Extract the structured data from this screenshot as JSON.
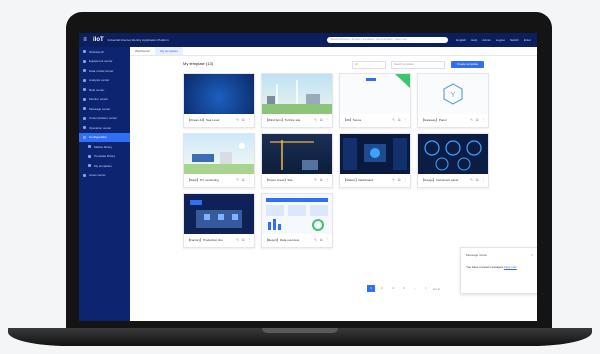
{
  "topbar": {
    "logo": "iIoT",
    "title": "Industrial Internet Identity Application Platform",
    "search_placeholder": "Search functions / devices / templates / documentation / alarm logs",
    "right_items": [
      "English",
      "Help",
      "Admin",
      "Logout",
      "Switch",
      "Enter"
    ]
  },
  "sidebar": {
    "items": [
      {
        "label": "Workbench"
      },
      {
        "label": "Equipment center"
      },
      {
        "label": "Data model center"
      },
      {
        "label": "Analysis center"
      },
      {
        "label": "Rule center"
      },
      {
        "label": "Monitor center"
      },
      {
        "label": "Message center"
      },
      {
        "label": "Customization center"
      },
      {
        "label": "Operation center"
      },
      {
        "label": "Configuration"
      },
      {
        "label": "Market library"
      },
      {
        "label": "Template library"
      },
      {
        "label": "My templates"
      },
      {
        "label": "Asset center"
      }
    ]
  },
  "tabs": [
    {
      "label": "Workbench"
    },
    {
      "label": "My templates"
    }
  ],
  "main": {
    "title": "My template (13)",
    "filter_placeholder": "All",
    "search_placeholder": "Search templates",
    "create_label": "Create template",
    "cards": [
      {
        "caption": "【Ocean-11】Sea Level"
      },
      {
        "caption": "【Wind farm】Turbine site"
      },
      {
        "caption": "【3D】Scene"
      },
      {
        "caption": "【Gateway】Panel"
      },
      {
        "caption": "【Solar】PV monitoring"
      },
      {
        "caption": "【Tower crane】Site"
      },
      {
        "caption": "【Station】Dashboard"
      },
      {
        "caption": "【Gauge】Instrument panel"
      },
      {
        "caption": "【Factory】Production line"
      },
      {
        "caption": "【Report】Data overview"
      }
    ],
    "action_icons": [
      "edit-icon",
      "copy-icon",
      "more-icon"
    ]
  },
  "pager": {
    "pages": [
      "1",
      "2",
      "3",
      "4",
      "..."
    ],
    "next": ">",
    "goto": "Go to"
  },
  "toast": {
    "title": "Message notice",
    "close": "×",
    "message": "You have unread messages,",
    "link": "View now"
  },
  "colors": {
    "sidebar": "#0d2470",
    "topbar": "#0b1f5e",
    "accent": "#2f6ef5"
  }
}
